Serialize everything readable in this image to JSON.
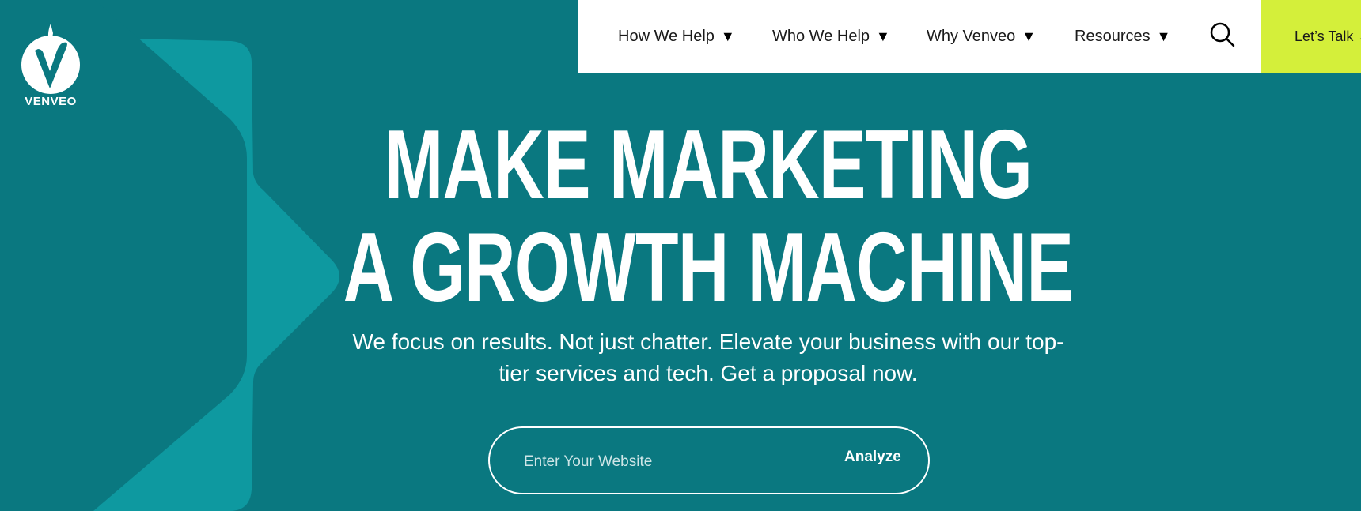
{
  "brand": {
    "name": "VENVEO"
  },
  "nav": {
    "items": [
      {
        "label": "How We Help",
        "caret": "▼"
      },
      {
        "label": "Who We Help",
        "caret": "▼"
      },
      {
        "label": "Why Venveo",
        "caret": "▼"
      },
      {
        "label": "Resources",
        "caret": "▼"
      }
    ],
    "search_icon": "search-icon",
    "cta_label": "Let’s Talk →"
  },
  "hero": {
    "headline_line1": "MAKE MARKETING",
    "headline_line2": "A GROWTH MACHINE",
    "subtext": "We focus on results. Not just chatter. Elevate your business with our top-tier services and tech. Get a proposal now.",
    "input_placeholder": "Enter Your Website",
    "button_label": "Analyze"
  },
  "colors": {
    "background": "#0a7880",
    "shape": "#0e99a0",
    "cta": "#d4ef3a",
    "nav_bg": "#ffffff"
  }
}
